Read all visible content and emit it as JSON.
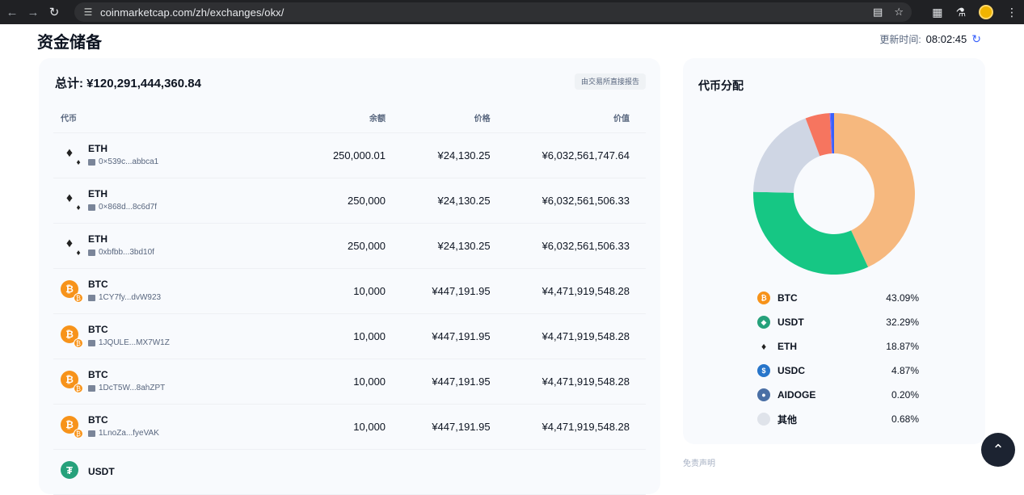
{
  "browser": {
    "url": "coinmarketcap.com/zh/exchanges/okx/"
  },
  "header": {
    "title": "资金储备",
    "update_label": "更新时间:",
    "update_time": "08:02:45"
  },
  "reserves": {
    "total": "总计: ¥120,291,444,360.84",
    "report_button": "由交易所直接报告",
    "columns": [
      "代币",
      "余额",
      "价格",
      "价值"
    ],
    "rows": [
      {
        "symbol": "ETH",
        "address": "0×539c...abbca1",
        "balance": "250,000.01",
        "price": "¥24,130.25",
        "value": "¥6,032,561,747.64"
      },
      {
        "symbol": "ETH",
        "address": "0×868d...8c6d7f",
        "balance": "250,000",
        "price": "¥24,130.25",
        "value": "¥6,032,561,506.33"
      },
      {
        "symbol": "ETH",
        "address": "0xbfbb...3bd10f",
        "balance": "250,000",
        "price": "¥24,130.25",
        "value": "¥6,032,561,506.33"
      },
      {
        "symbol": "BTC",
        "address": "1CY7fy...dvW923",
        "balance": "10,000",
        "price": "¥447,191.95",
        "value": "¥4,471,919,548.28"
      },
      {
        "symbol": "BTC",
        "address": "1JQULE...MX7W1Z",
        "balance": "10,000",
        "price": "¥447,191.95",
        "value": "¥4,471,919,548.28"
      },
      {
        "symbol": "BTC",
        "address": "1DcT5W...8ahZPT",
        "balance": "10,000",
        "price": "¥447,191.95",
        "value": "¥4,471,919,548.28"
      },
      {
        "symbol": "BTC",
        "address": "1LnoZa...fyeVAK",
        "balance": "10,000",
        "price": "¥447,191.95",
        "value": "¥4,471,919,548.28"
      },
      {
        "symbol": "USDT",
        "address": "",
        "balance": "",
        "price": "",
        "value": ""
      }
    ]
  },
  "distribution": {
    "title": "代币分配",
    "colors": {
      "BTC": "#f6b87e",
      "USDT": "#16c784",
      "ETH": "#cfd6e4",
      "USDC": "#f6755f",
      "AIDOGE": "#7b61ff",
      "其他": "#3861fb"
    },
    "items": [
      {
        "name": "BTC",
        "pct": "43.09%",
        "value": 43.09
      },
      {
        "name": "USDT",
        "pct": "32.29%",
        "value": 32.29
      },
      {
        "name": "ETH",
        "pct": "18.87%",
        "value": 18.87
      },
      {
        "name": "USDC",
        "pct": "4.87%",
        "value": 4.87
      },
      {
        "name": "AIDOGE",
        "pct": "0.20%",
        "value": 0.2
      },
      {
        "name": "其他",
        "pct": "0.68%",
        "value": 0.68
      }
    ],
    "disclaimer": "免责声明"
  }
}
